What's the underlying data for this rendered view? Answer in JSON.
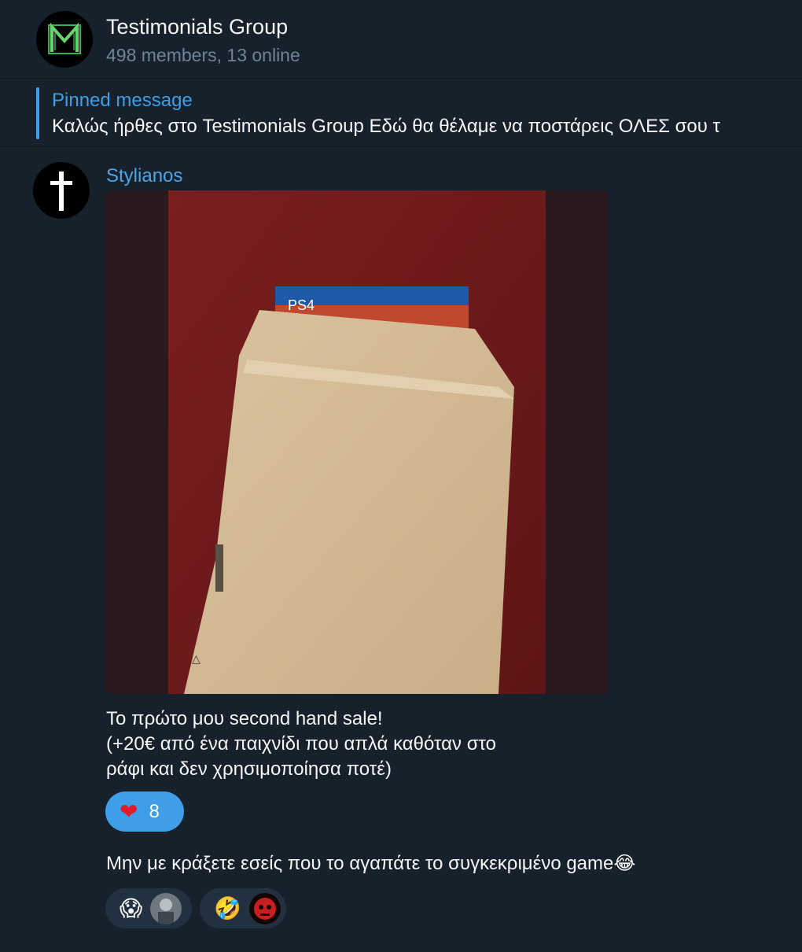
{
  "header": {
    "title": "Testimonials Group",
    "subtitle": "498 members, 13 online",
    "avatar_letter": "M"
  },
  "pinned": {
    "label": "Pinned message",
    "text": "Καλώς ήρθες στο Testimonials Group  Εδώ θα θέλαμε να ποστάρεις ΟΛΕΣ σου τ"
  },
  "message1": {
    "sender": "Stylianos",
    "caption_lines": [
      "Το πρώτο μου second hand sale!",
      "(+20€ από ένα παιχνίδι που απλά καθόταν στο",
      "ράφι και δεν χρησιμοποίησα ποτέ)"
    ],
    "photo_label": "PS4",
    "reaction": {
      "emoji": "❤",
      "count": "8"
    }
  },
  "message2": {
    "text": "Μην με κράξετε εσείς που το αγαπάτε το συγκεκριμένο game😂",
    "reactions": [
      {
        "emoji": "😱"
      },
      {
        "emoji": "🤣"
      }
    ]
  },
  "colors": {
    "background": "#17212b",
    "accent": "#3e9fe8",
    "muted": "#708499"
  }
}
